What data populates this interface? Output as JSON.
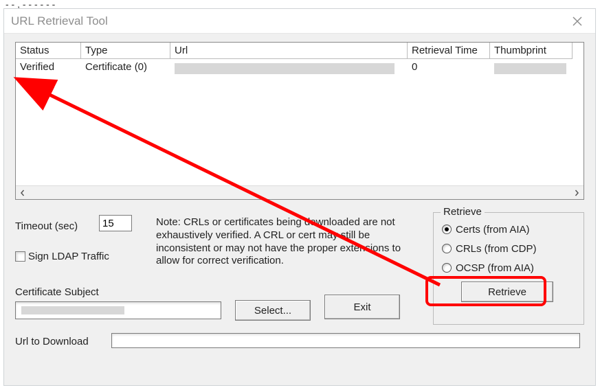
{
  "fragment": "- - , - - - - - -",
  "titlebar": {
    "title": "URL Retrieval Tool"
  },
  "table": {
    "headers": [
      "Status",
      "Type",
      "Url",
      "Retrieval Time",
      "Thumbprint"
    ],
    "rows": [
      {
        "status": "Verified",
        "type": "Certificate (0)",
        "url": "",
        "retrieval_time": "0",
        "thumbprint": ""
      }
    ]
  },
  "controls": {
    "timeout_label": "Timeout (sec)",
    "timeout_value": "15",
    "note": "Note: CRLs or certificates being downloaded are not exhaustively verified.  A CRL or cert may still be inconsistent or may not have the proper extensions to allow for correct verification.",
    "sign_ldap_label": "Sign LDAP Traffic",
    "cert_subject_label": "Certificate Subject",
    "select_label": "Select...",
    "exit_label": "Exit",
    "url_download_label": "Url to Download"
  },
  "retrieve": {
    "legend": "Retrieve",
    "options": [
      {
        "label": "Certs (from AIA)",
        "checked": true
      },
      {
        "label": "CRLs (from CDP)",
        "checked": false
      },
      {
        "label": "OCSP (from AIA)",
        "checked": false
      }
    ],
    "button_label": "Retrieve"
  },
  "annotations": {
    "arrow_target": "status-cell",
    "highlight_target": "retrieve-button",
    "arrow_color": "#ff0000"
  }
}
